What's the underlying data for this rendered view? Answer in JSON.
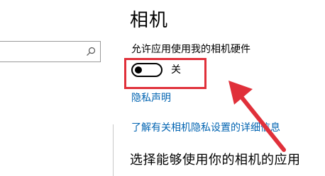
{
  "page": {
    "title": "相机"
  },
  "setting": {
    "label": "允许应用使用我的相机硬件",
    "toggle_state_text": "关",
    "toggle_on": false
  },
  "links": {
    "privacy_statement": "隐私声明",
    "learn_more": "了解有关相机隐私设置的详细信息"
  },
  "section": {
    "heading": "选择能够使用你的相机的应用"
  },
  "colors": {
    "accent_link": "#0063b1",
    "annotation_red": "#e0303a"
  },
  "icons": {
    "search": "search-icon"
  }
}
